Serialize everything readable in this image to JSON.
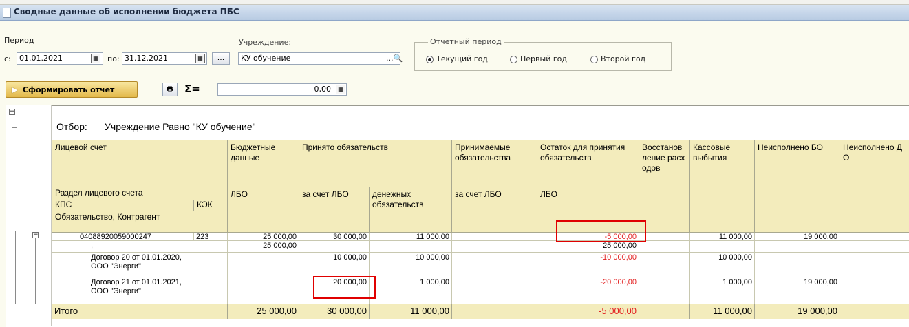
{
  "window": {
    "title": "Сводные данные об исполнении бюджета ПБС"
  },
  "form": {
    "period_label": "Период",
    "from_label": "с:",
    "from_value": "01.01.2021",
    "to_label": "по:",
    "to_value": "31.12.2021",
    "dots_label": "...",
    "institution_label": "Учреждение:",
    "institution_value": "КУ обучение",
    "reporting_period": {
      "legend": "Отчетный период",
      "options": [
        {
          "label": "Текущий год",
          "selected": true
        },
        {
          "label": "Первый год",
          "selected": false
        },
        {
          "label": "Второй год",
          "selected": false
        }
      ]
    },
    "generate_label": "Сформировать отчет",
    "sum_symbol": "Σ=",
    "sum_value": "0,00"
  },
  "report": {
    "filter_label": "Отбор:",
    "filter_text": "Учреждение Равно \"КУ обучение\"",
    "headers": {
      "account": "Лицевой счет",
      "budget": "Бюджетные данные",
      "accepted": "Принято обязательств",
      "accepting": "Принимаемые обязательства",
      "remaining": "Остаток для принятия обязательств",
      "restore": "Восстановление расходов",
      "cash": "Кассовые выбытия",
      "unexec_bo": "Неисполнено БО",
      "unexec_do": "Неисполнено ДО",
      "section": "Раздел лицевого счета",
      "kps": "КПС",
      "kek": "КЭК",
      "obligation": "Обязательство, Контрагент",
      "lbo1": "ЛБО",
      "za_schet_lbo": "за счет ЛБО",
      "money_obl": "денежных обязательств",
      "za_schet_lbo2": "за счет ЛБО",
      "lbo2": "ЛБО"
    },
    "rows": [
      {
        "name": "04088920059000247",
        "kek": "223",
        "budget": "25 000,00",
        "accepted_lbo": "30 000,00",
        "accepted_money": "11 000,00",
        "accepting": "",
        "remaining": "-5 000,00",
        "restore": "",
        "cash": "11 000,00",
        "unexec_bo": "19 000,00",
        "unexec_do": ""
      },
      {
        "name": ",",
        "kek": "",
        "budget": "25 000,00",
        "accepted_lbo": "",
        "accepted_money": "",
        "accepting": "",
        "remaining": "25 000,00",
        "restore": "",
        "cash": "",
        "unexec_bo": "",
        "unexec_do": ""
      },
      {
        "name": "Договор 20 от 01.01.2020, ООО \"Энерги\"",
        "kek": "",
        "budget": "",
        "accepted_lbo": "10 000,00",
        "accepted_money": "10 000,00",
        "accepting": "",
        "remaining": "-10 000,00",
        "restore": "",
        "cash": "10 000,00",
        "unexec_bo": "",
        "unexec_do": ""
      },
      {
        "name": "Договор 21 от 01.01.2021, ООО \"Энерги\"",
        "kek": "",
        "budget": "",
        "accepted_lbo": "20 000,00",
        "accepted_money": "1 000,00",
        "accepting": "",
        "remaining": "-20 000,00",
        "restore": "",
        "cash": "1 000,00",
        "unexec_bo": "19 000,00",
        "unexec_do": ""
      }
    ],
    "total": {
      "label": "Итого",
      "budget": "25 000,00",
      "accepted_lbo": "30 000,00",
      "accepted_money": "11 000,00",
      "remaining": "-5 000,00",
      "cash": "11 000,00",
      "unexec_bo": "19 000,00"
    }
  }
}
